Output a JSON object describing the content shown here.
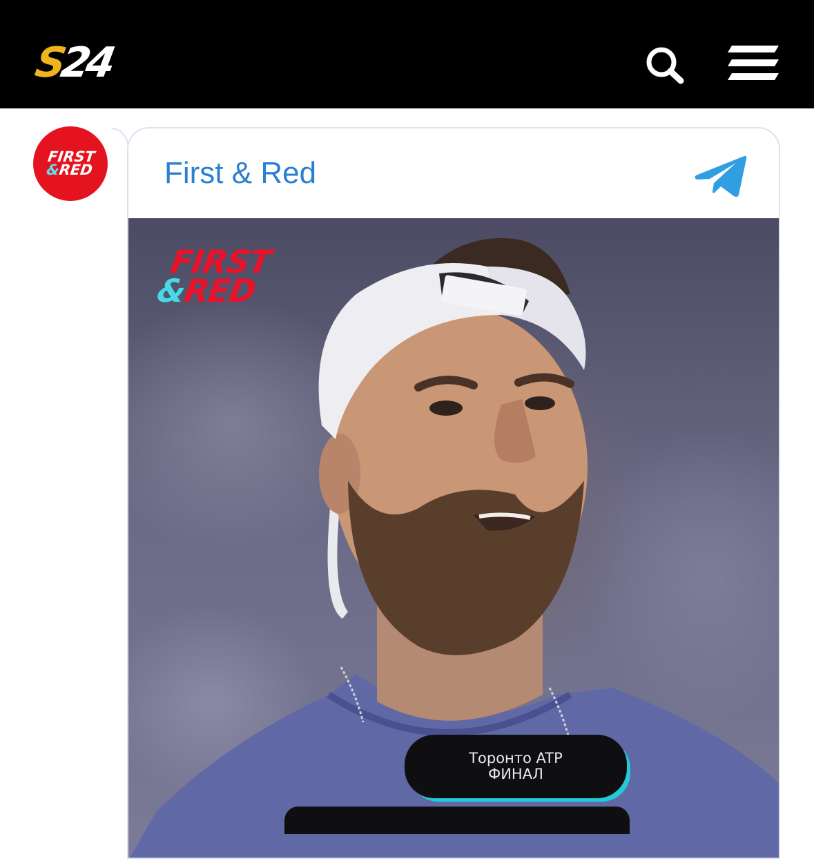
{
  "header": {
    "logo": {
      "part1": "S",
      "part2": "24"
    },
    "search_icon": "search-icon",
    "menu_icon": "hamburger-menu-icon"
  },
  "post": {
    "channel_name": "First & Red",
    "avatar": {
      "line1": "FIRST",
      "amp": "&",
      "line2": "RED"
    },
    "source_icon": "telegram-icon",
    "image": {
      "logo": {
        "line1": "FIRST",
        "amp": "&",
        "line2": "RED"
      },
      "caption_line1": "Торонто ATP",
      "caption_line2": "ФИНАЛ"
    }
  },
  "colors": {
    "header_bg": "#000000",
    "logo_yellow": "#f0b41c",
    "brand_red": "#e4131f",
    "brand_cyan": "#5de2ec",
    "channel_blue": "#2a7fd0",
    "telegram_blue": "#2f9ee3"
  }
}
